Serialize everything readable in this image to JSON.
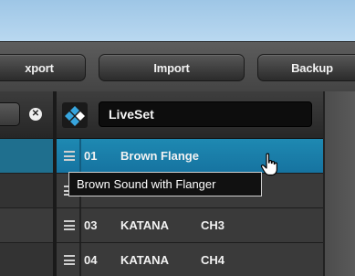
{
  "toolbar": {
    "export_label": "xport",
    "import_label": "Import",
    "backup_label": "Backup"
  },
  "liveset": {
    "name": "LiveSet"
  },
  "list": {
    "items": [
      {
        "number": "01",
        "name": "Brown Flange",
        "channel": "",
        "selected": true
      },
      {
        "number": "",
        "name": "",
        "channel": "",
        "selected": false
      },
      {
        "number": "03",
        "name": "KATANA",
        "channel": "CH3",
        "selected": false
      },
      {
        "number": "04",
        "name": "KATANA",
        "channel": "CH4",
        "selected": false
      }
    ]
  },
  "tooltip": {
    "text": "Brown Sound with Flanger"
  },
  "icons": {
    "logo": "boss-diamond-logo-icon",
    "clear": "clear-x-icon",
    "grip": "drag-handle-icon",
    "cursor": "hand-pointer-icon"
  },
  "colors": {
    "selected_row": "#1e89b2",
    "title_bar": "#b9d8f0",
    "logo_accent": "#37a5de"
  }
}
